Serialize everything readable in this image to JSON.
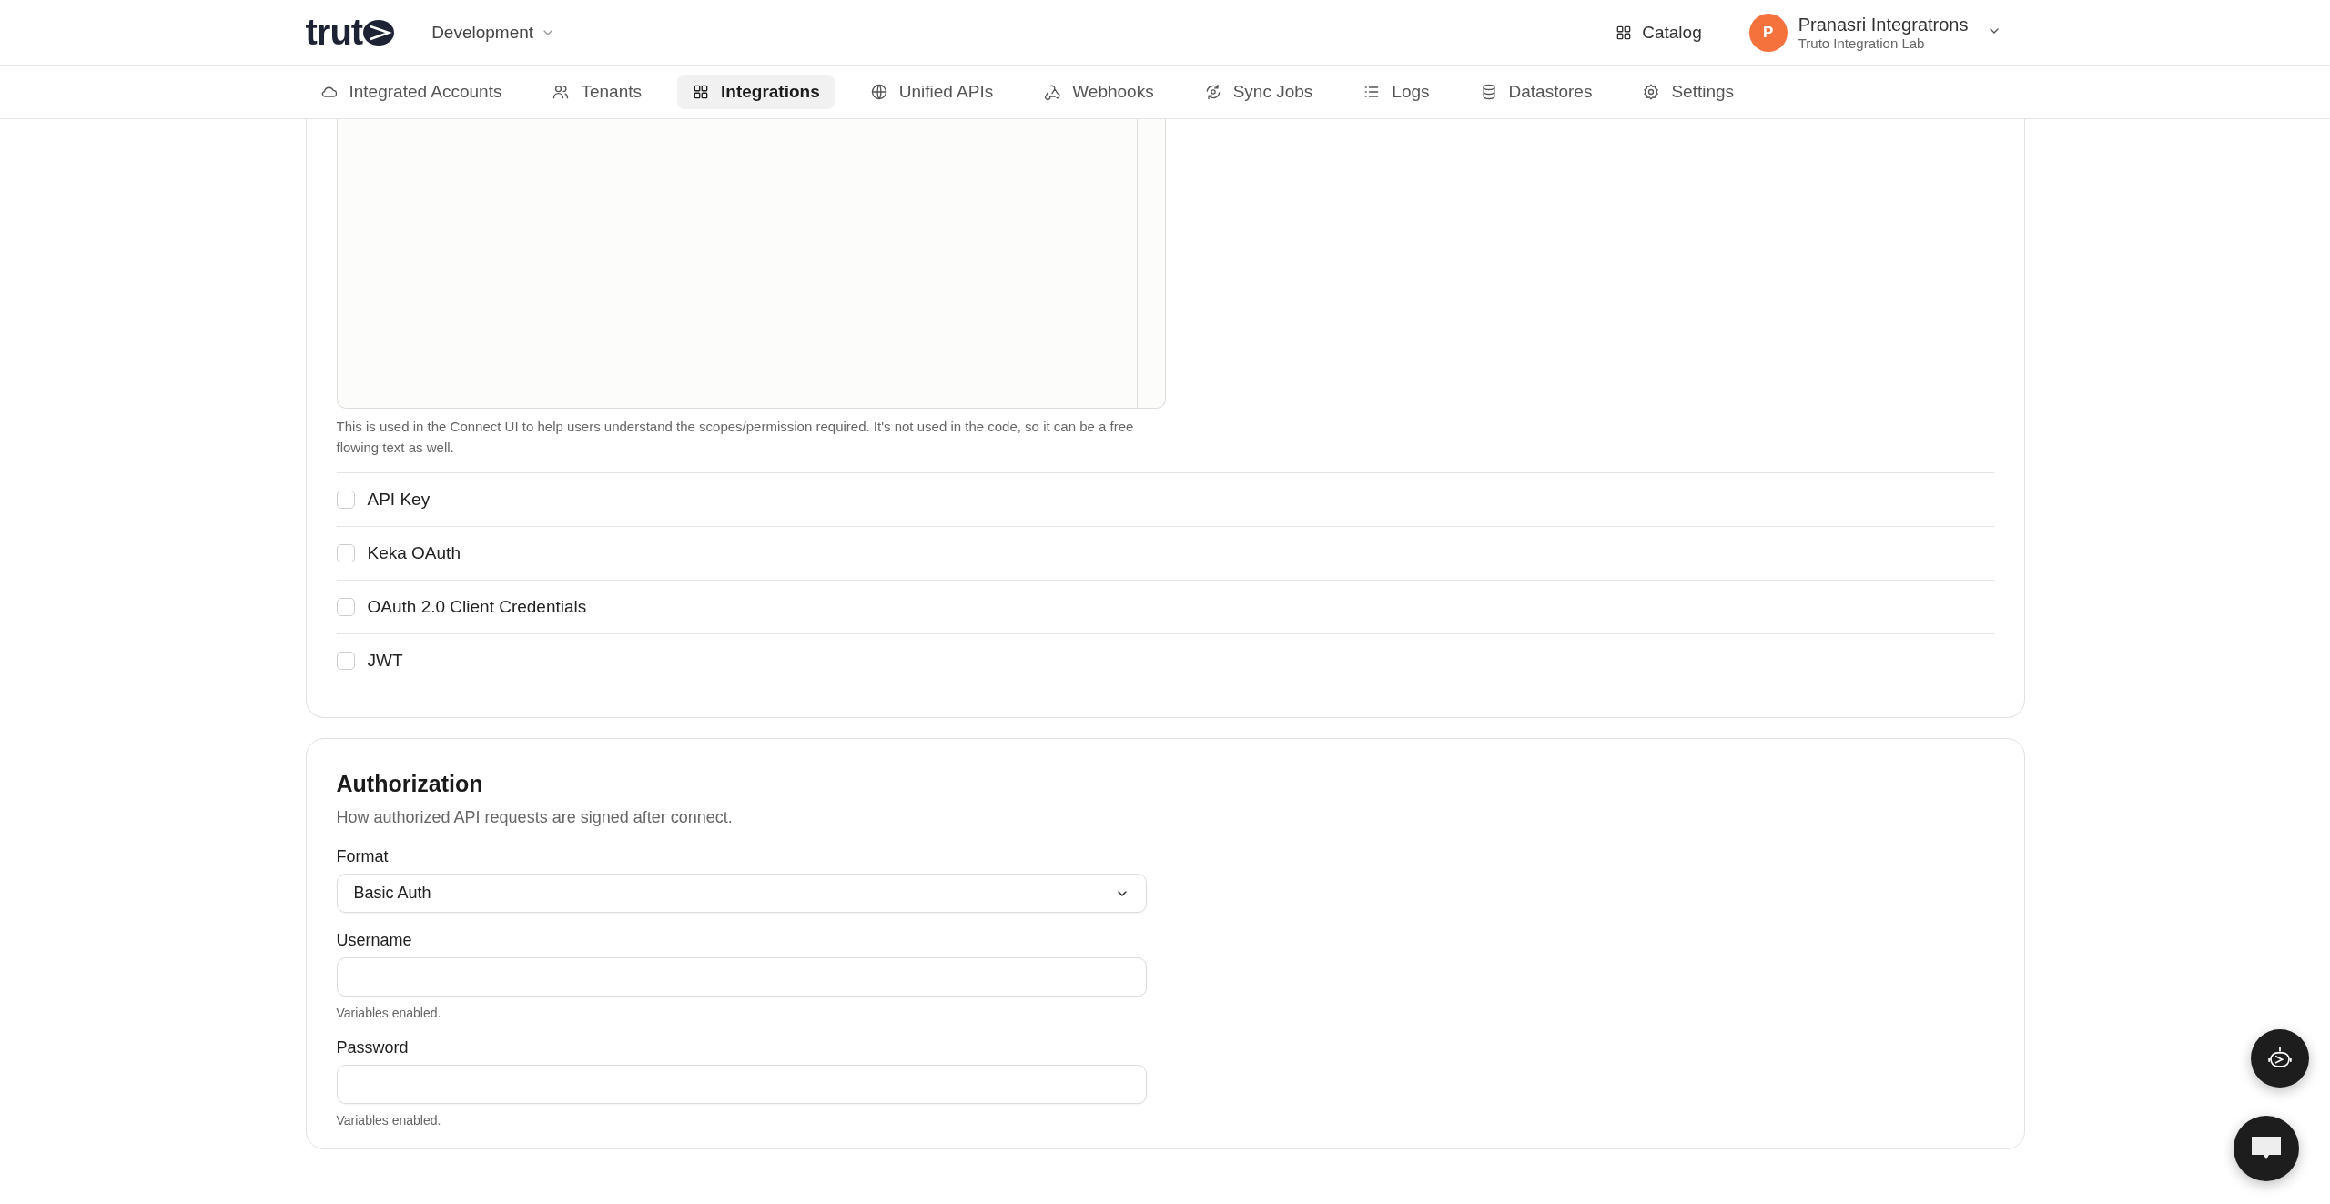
{
  "header": {
    "logo_text": "trut",
    "environment": "Development",
    "catalog": "Catalog",
    "user": {
      "initial": "P",
      "name": "Pranasri Integratrons",
      "org": "Truto Integration Lab"
    }
  },
  "nav": [
    {
      "label": "Integrated Accounts",
      "selected": false
    },
    {
      "label": "Tenants",
      "selected": false
    },
    {
      "label": "Integrations",
      "selected": true
    },
    {
      "label": "Unified APIs",
      "selected": false
    },
    {
      "label": "Webhooks",
      "selected": false
    },
    {
      "label": "Sync Jobs",
      "selected": false
    },
    {
      "label": "Logs",
      "selected": false
    },
    {
      "label": "Datastores",
      "selected": false
    },
    {
      "label": "Settings",
      "selected": false
    }
  ],
  "scopes_card": {
    "help": "This is used in the Connect UI to help users understand the scopes/permission required. It's not used in the code, so it can be a free flowing text as well.",
    "auth_methods": [
      {
        "label": "API Key",
        "checked": false
      },
      {
        "label": "Keka OAuth",
        "checked": false
      },
      {
        "label": "OAuth 2.0 Client Credentials",
        "checked": false
      },
      {
        "label": "JWT",
        "checked": false
      }
    ]
  },
  "authorization": {
    "title": "Authorization",
    "subtitle": "How authorized API requests are signed after connect.",
    "fields": [
      {
        "kind": "select",
        "label": "Format",
        "value": "Basic Auth"
      },
      {
        "kind": "text",
        "label": "Username",
        "hint": "Variables enabled."
      },
      {
        "kind": "text",
        "label": "Password",
        "hint": "Variables enabled."
      }
    ]
  }
}
